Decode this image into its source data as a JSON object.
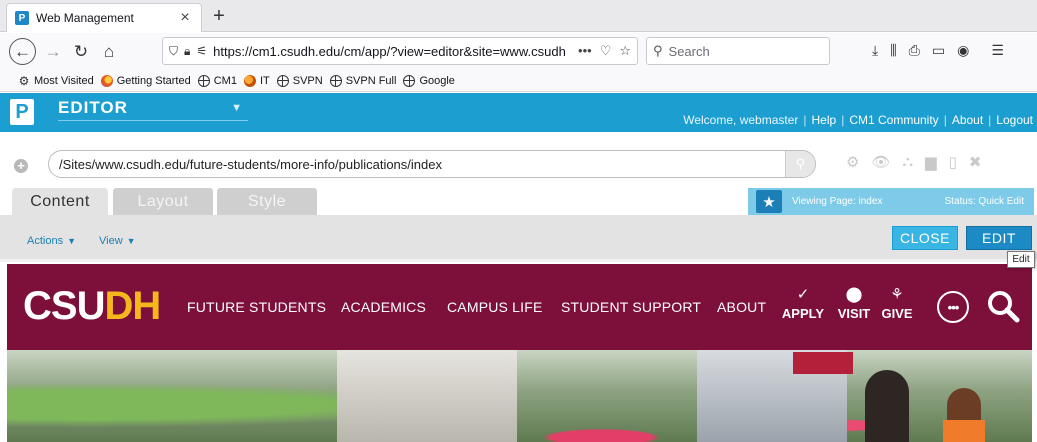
{
  "browser": {
    "tab_title": "Web Management",
    "tab_close": "×",
    "new_tab": "+",
    "url": "https://cm1.csudh.edu/cm/app/?view=editor&site=www.csudh",
    "url_more": "•••",
    "search_placeholder": "Search",
    "bookmarks": [
      {
        "label": "Most Visited",
        "icon": "gear-icon"
      },
      {
        "label": "Getting Started",
        "icon": "firefox-icon"
      },
      {
        "label": "CM1",
        "icon": "globe-icon"
      },
      {
        "label": "IT",
        "icon": "orange-globe-icon"
      },
      {
        "label": "SVPN",
        "icon": "globe-icon"
      },
      {
        "label": "SVPN Full",
        "icon": "globe-icon"
      },
      {
        "label": "Google",
        "icon": "globe-icon"
      }
    ]
  },
  "cms": {
    "logo_letter": "P",
    "editor_label": "EDITOR",
    "header_links": {
      "welcome": "Welcome, webmaster",
      "help": "Help",
      "community": "CM1 Community",
      "about": "About",
      "logout": "Logout",
      "separator": "|"
    },
    "path": "/Sites/www.csudh.edu/future-students/more-info/publications/index",
    "tabs": {
      "content": "Content",
      "layout": "Layout",
      "style": "Style"
    },
    "viewing": "Viewing Page: index",
    "status": "Status: Quick Edit",
    "actions_menu": "Actions",
    "view_menu": "View",
    "close_button": "CLOSE",
    "edit_button": "EDIT",
    "tooltip": "Edit",
    "colors": {
      "header": "#1c9ed1",
      "edit": "#1c8ac5",
      "close": "#39b5e3"
    }
  },
  "site": {
    "logo_csu": "CSU",
    "logo_dh": "DH",
    "nav": {
      "future_students": "FUTURE STUDENTS",
      "academics": "ACADEMICS",
      "campus_life": "CAMPUS LIFE",
      "student_support": "STUDENT SUPPORT",
      "about": "ABOUT"
    },
    "quick_links": {
      "apply": "APPLY",
      "visit": "VISIT",
      "give": "GIVE"
    },
    "more_glyph": "•••",
    "colors": {
      "nav": "#7d0f3b",
      "gold": "#f5b81c"
    }
  }
}
